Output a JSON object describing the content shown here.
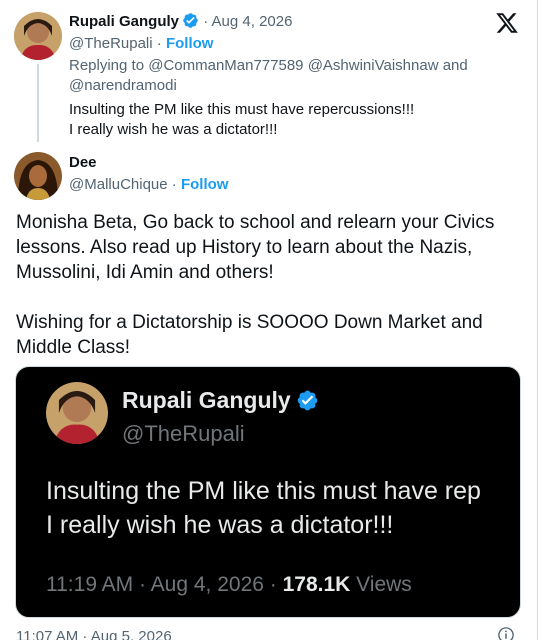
{
  "parent_tweet": {
    "name": "Rupali Ganguly",
    "separator": "·",
    "date": "Aug 4, 2026",
    "handle": "@TheRupali",
    "follow": "Follow",
    "reply_to": "Replying to @CommanMan777589 @AshwiniVaishnaw and @narendramodi",
    "lines": [
      "Insulting the PM like this must have repercussions!!!",
      "I really wish he was a dictator!!!"
    ]
  },
  "main_tweet": {
    "name": "Dee",
    "handle": "@MalluChique",
    "separator": "·",
    "follow": "Follow",
    "paragraph1": "Monisha Beta, Go back to school and relearn your Civics lessons. Also read up History to learn about the Nazis, Mussolini, Idi Amin and others!",
    "paragraph2": "Wishing for a Dictatorship is SOOOO Down Market and Middle Class!",
    "timestamp": "11:07 AM · Aug 5, 2026"
  },
  "embedded_screenshot": {
    "name": "Rupali Ganguly",
    "handle": "@TheRupali",
    "line1": "Insulting the PM like this must have rep",
    "line2": "I really wish he was a dictator!!!",
    "time": "11:19 AM · Aug 4, 2026 · ",
    "views_count": "178.1K",
    "views_label": " Views"
  },
  "icons": {
    "logo": "x-logo-icon",
    "verified": "verified-badge-icon",
    "info": "info-icon"
  },
  "colors": {
    "accent": "#1d9bf0",
    "secondary_text": "#536471",
    "dark_bg": "#000000"
  }
}
